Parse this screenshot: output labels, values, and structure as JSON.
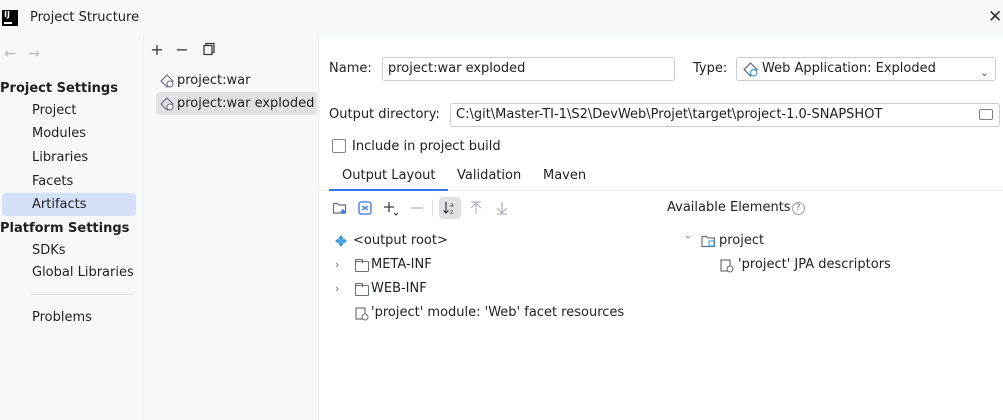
{
  "window": {
    "title": "Project Structure"
  },
  "nav": {
    "back_icon": "arrow-left-icon",
    "forward_icon": "arrow-right-icon",
    "project_settings_header": "Project Settings",
    "project_settings": [
      "Project",
      "Modules",
      "Libraries",
      "Facets",
      "Artifacts"
    ],
    "platform_settings_header": "Platform Settings",
    "platform_settings": [
      "SDKs",
      "Global Libraries"
    ],
    "problems": "Problems",
    "selected": "Artifacts"
  },
  "artifacts": {
    "toolbar": [
      "plus-icon",
      "minus-icon",
      "copy-icon"
    ],
    "items": [
      "project:war",
      "project:war exploded"
    ],
    "selected": "project:war exploded"
  },
  "form": {
    "name_label": "Name:",
    "name_value": "project:war exploded",
    "type_label": "Type:",
    "type_value": "Web Application: Exploded",
    "output_dir_label": "Output directory:",
    "output_dir_value": "C:\\git\\Master-TI-1\\S2\\DevWeb\\Projet\\target\\project-1.0-SNAPSHOT",
    "include_build_label": "Include in project build",
    "include_build_checked": false
  },
  "tabs": [
    "Output Layout",
    "Validation",
    "Maven"
  ],
  "active_tab": "Output Layout",
  "layout_toolbar": [
    "new-folder-icon",
    "archive-icon",
    "add-icon",
    "remove-icon",
    "sort-icon",
    "move-up-icon",
    "move-down-icon"
  ],
  "output_tree": [
    {
      "label": "<output root>",
      "icon": "output-root-icon"
    },
    {
      "label": "META-INF",
      "icon": "folder-icon",
      "expandable": true
    },
    {
      "label": "WEB-INF",
      "icon": "folder-icon",
      "expandable": true
    },
    {
      "label": "'project' module: 'Web' facet resources",
      "icon": "facet-resource-icon"
    }
  ],
  "available": {
    "title": "Available Elements",
    "tree": [
      {
        "label": "project",
        "icon": "module-folder-icon",
        "expanded": true
      },
      {
        "label": "'project' JPA descriptors",
        "icon": "jpa-descriptor-icon"
      }
    ]
  },
  "colors": {
    "accent": "#3574f0",
    "selection": "#d5e1f8",
    "panel": "#f7f8fa",
    "root_icon": "#3c9ae0"
  }
}
